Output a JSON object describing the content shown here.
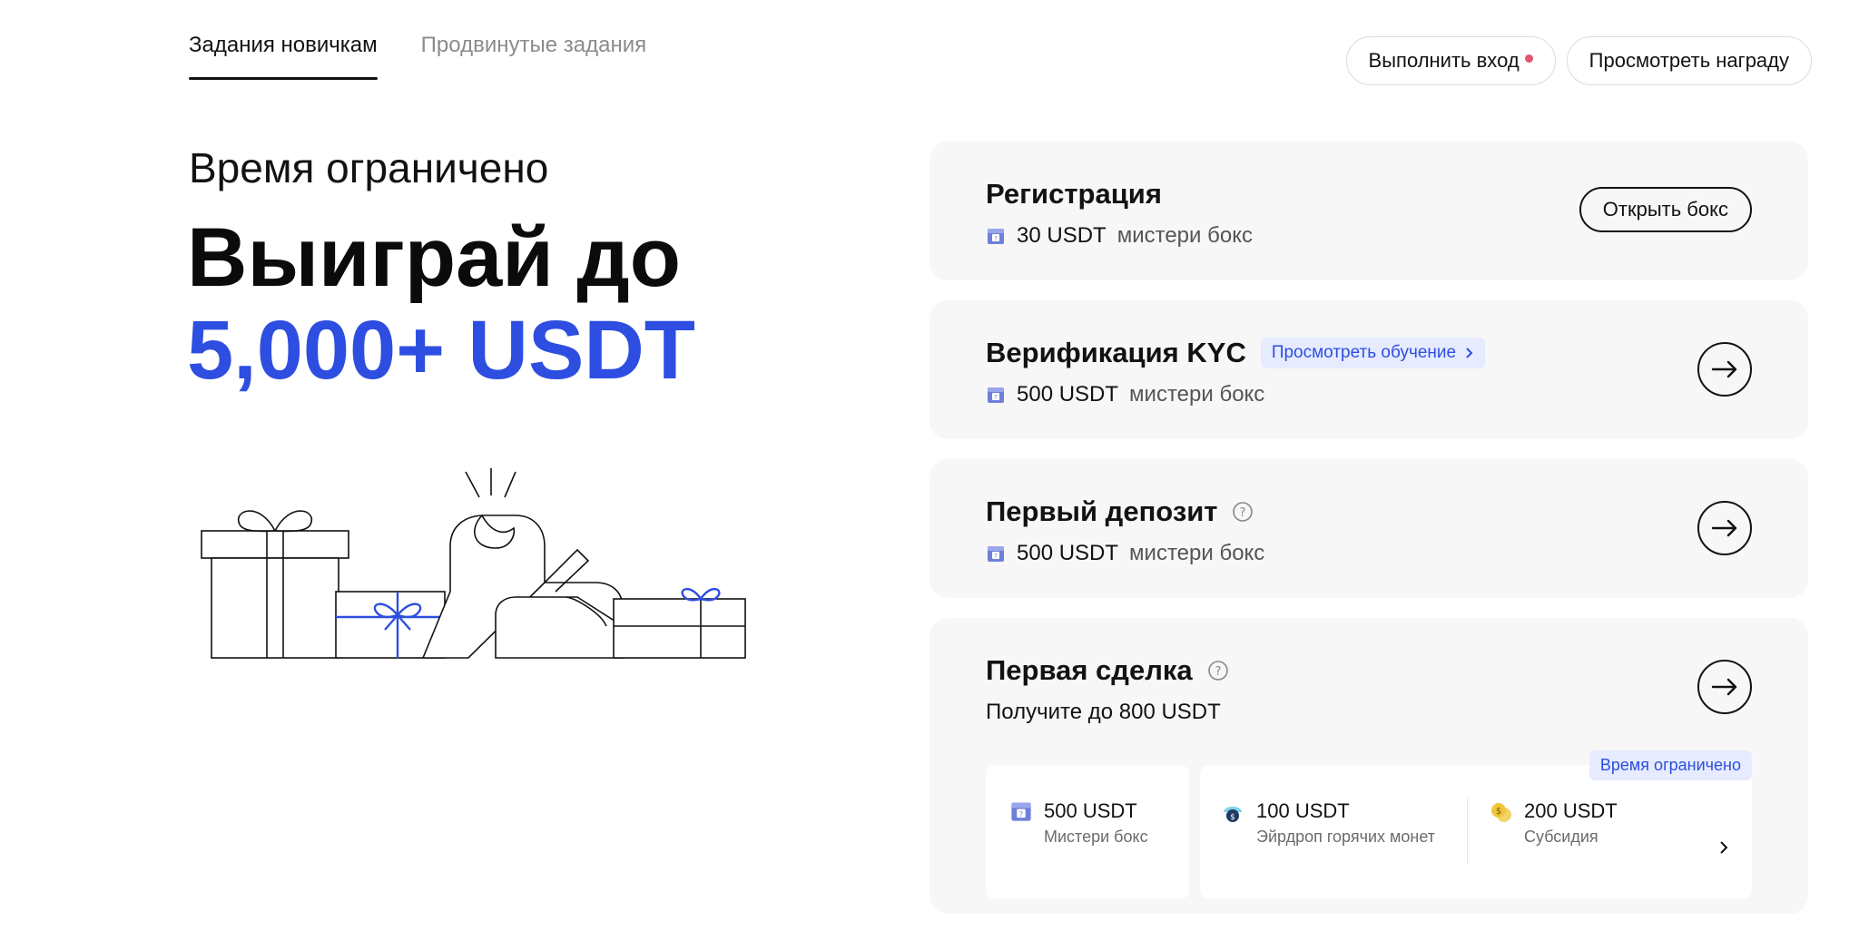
{
  "tabs": [
    {
      "label": "Задания новичкам",
      "active": true
    },
    {
      "label": "Продвинутые задания",
      "active": false
    }
  ],
  "top_actions": {
    "login_label": "Выполнить вход",
    "view_reward_label": "Просмотреть награду"
  },
  "hero": {
    "subtitle": "Время ограничено",
    "title": "Выиграй до",
    "amount": "5,000+ USDT"
  },
  "tasks": {
    "registration": {
      "title": "Регистрация",
      "reward_amount": "30 USDT",
      "reward_label": "мистери бокс",
      "button_label": "Открыть бокс"
    },
    "kyc": {
      "title": "Верификация KYC",
      "tutorial_label": "Просмотреть обучение",
      "reward_amount": "500 USDT",
      "reward_label": "мистери бокс"
    },
    "first_deposit": {
      "title": "Первый депозит",
      "reward_amount": "500 USDT",
      "reward_label": "мистери бокс"
    },
    "first_trade": {
      "title": "Первая сделка",
      "subtitle": "Получите до 800 USDT",
      "limited_tag": "Время ограничено",
      "rewards": [
        {
          "amount": "500 USDT",
          "label": "Мистери бокс",
          "icon": "mystery-box-icon"
        },
        {
          "amount": "100 USDT",
          "label": "Эйрдроп горячих монет",
          "icon": "airdrop-icon"
        },
        {
          "amount": "200 USDT",
          "label": "Субсидия",
          "icon": "coin-icon"
        }
      ]
    }
  },
  "colors": {
    "accent_blue": "#2d4ee0",
    "card_bg": "#f7f7f7",
    "tag_bg": "#e6ebff",
    "notification_dot": "#e0566b"
  }
}
